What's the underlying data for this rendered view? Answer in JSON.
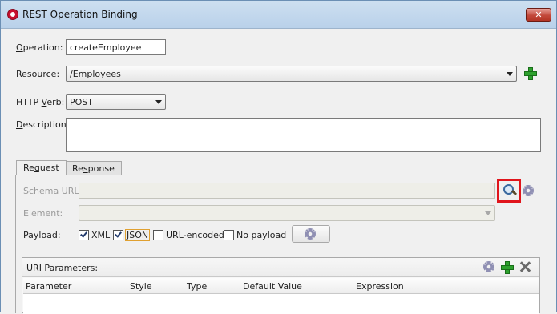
{
  "window": {
    "title": "REST Operation Binding",
    "close_label": "✕"
  },
  "form": {
    "operation_label": "Operation:",
    "operation_value": "createEmployee",
    "resource_label": "Resource:",
    "resource_value": "/Employees",
    "http_verb_label": "HTTP Verb:",
    "http_verb_value": "POST",
    "description_label": "Description:",
    "description_value": ""
  },
  "tabs": [
    {
      "label": "Request",
      "active": true
    },
    {
      "label": "Response",
      "active": false
    }
  ],
  "request": {
    "schema_url_label": "Schema URL:",
    "schema_url_value": "",
    "element_label": "Element:",
    "element_value": "",
    "payload_label": "Payload:",
    "payload_options": [
      {
        "label": "XML",
        "checked": true
      },
      {
        "label": "JSON",
        "checked": true
      },
      {
        "label": "URL-encoded",
        "checked": false
      },
      {
        "label": "No payload",
        "checked": false
      }
    ]
  },
  "uri_parameters": {
    "title": "URI Parameters:",
    "columns": [
      "Parameter",
      "Style",
      "Type",
      "Default Value",
      "Expression"
    ],
    "rows": []
  },
  "icons": {
    "app": "oracle-app-icon",
    "add": "plus-icon",
    "search": "magnifier-icon",
    "settings": "gear-icon",
    "delete": "delete-icon"
  },
  "colors": {
    "titlebar": "#b9d1ea",
    "close": "#c3493b",
    "highlight": "#e0151c",
    "add": "#2ea12e"
  }
}
